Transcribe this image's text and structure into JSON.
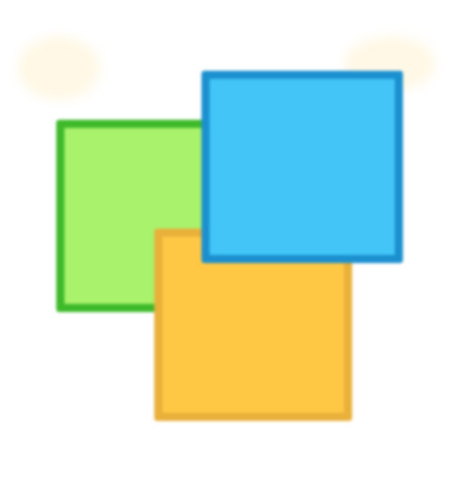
{
  "icon": {
    "name": "overlapping-squares-icon",
    "colors": {
      "green_fill": "#a9f26b",
      "green_border": "#3db92a",
      "orange_fill": "#ffc844",
      "orange_border": "#e9b03a",
      "blue_fill": "#43c6f7",
      "blue_border": "#1b90cf",
      "background": "#ffffff"
    }
  }
}
